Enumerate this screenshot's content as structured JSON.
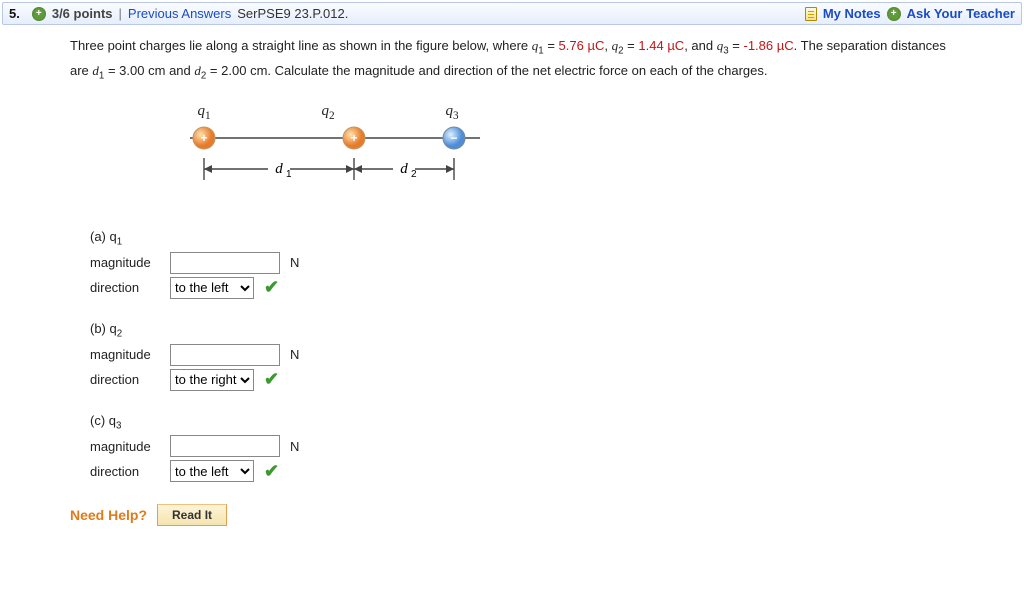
{
  "header": {
    "number": "5.",
    "points": "3/6 points",
    "sep": "|",
    "prev_answers": "Previous Answers",
    "assignment": "SerPSE9 23.P.012.",
    "my_notes": "My Notes",
    "ask": "Ask Your Teacher"
  },
  "problem": {
    "p1a": "Three point charges lie along a straight line as shown in the figure below, where ",
    "q1v": "5.76",
    "q2v": "1.44",
    "q3v": "-1.86",
    "unit": "µC",
    "p2a": ". The separation distances are ",
    "d1v": "3.00",
    "d2v": "2.00",
    "cm": "cm",
    "p2b": ". Calculate the magnitude and direction of the net electric force on each of the charges."
  },
  "figure": {
    "q1": "q1",
    "q2": "q2",
    "q3": "q3",
    "d1": "d1",
    "d2": "d2"
  },
  "labels": {
    "magnitude": "magnitude",
    "direction": "direction",
    "N": "N",
    "options": [
      "to the left",
      "to the right"
    ]
  },
  "parts": {
    "a": {
      "title": "(a) q",
      "sub": "1",
      "dir": "to the left"
    },
    "b": {
      "title": "(b) q",
      "sub": "2",
      "dir": "to the right"
    },
    "c": {
      "title": "(c) q",
      "sub": "3",
      "dir": "to the left"
    }
  },
  "help": {
    "label": "Need Help?",
    "read": "Read It"
  }
}
